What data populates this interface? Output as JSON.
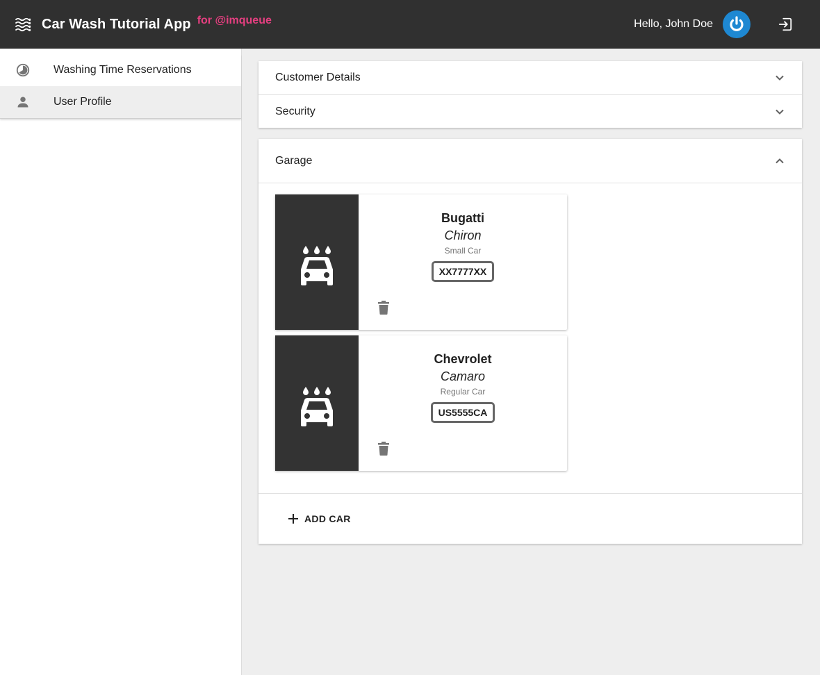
{
  "header": {
    "title": "Car Wash Tutorial App",
    "subtitle": "for @imqueue",
    "greeting": "Hello, John Doe",
    "menu_icon": "waves-menu-icon",
    "avatar_icon": "power-icon",
    "logout_icon": "logout-icon",
    "bg_color": "#303030",
    "accent_color": "#e53f80",
    "avatar_color": "#1e88d2"
  },
  "sidebar": {
    "items": [
      {
        "label": "Washing Time Reservations",
        "icon": "clock-icon",
        "active": false
      },
      {
        "label": "User Profile",
        "icon": "person-icon",
        "active": true
      }
    ]
  },
  "panels": [
    {
      "label": "Customer Details",
      "expanded": false
    },
    {
      "label": "Security",
      "expanded": false
    }
  ],
  "garage": {
    "label": "Garage",
    "expanded": true,
    "cars": [
      {
        "make": "Bugatti",
        "model": "Chiron",
        "type": "Small Car",
        "plate": "XX7777XX"
      },
      {
        "make": "Chevrolet",
        "model": "Camaro",
        "type": "Regular Car",
        "plate": "US5555CA"
      }
    ],
    "add_label": "ADD CAR"
  }
}
